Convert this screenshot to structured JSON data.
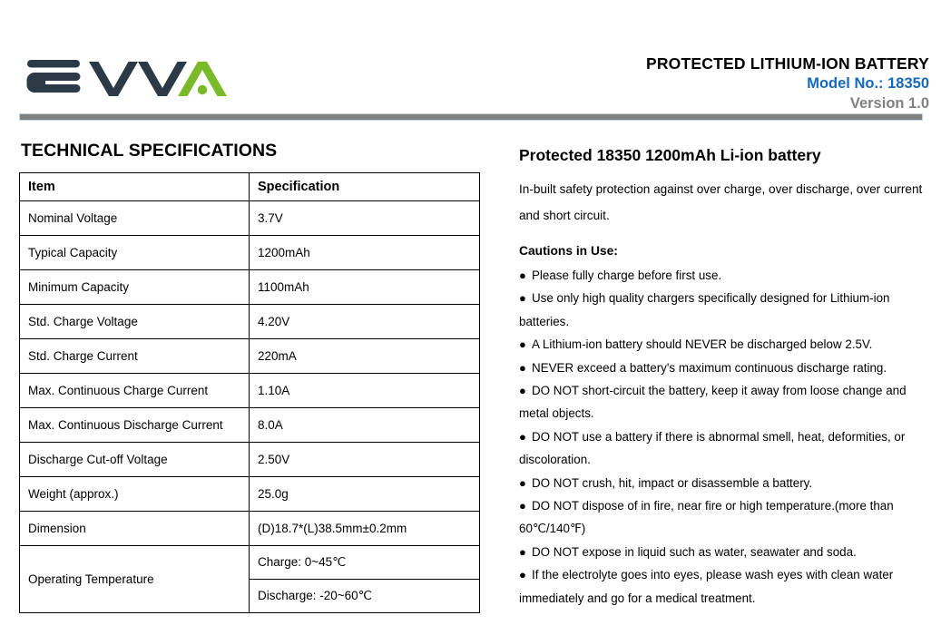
{
  "header": {
    "logo_text": "EVVA",
    "logo_colors": {
      "dark": "#2b3a46",
      "green": "#7ab929"
    },
    "title": "PROTECTED LITHIUM-ION BATTERY",
    "model": "Model No.: 18350",
    "version": "Version 1.0",
    "model_color": "#1569bd",
    "version_color": "#808080"
  },
  "left": {
    "section_title": "TECHNICAL SPECIFICATIONS",
    "table": {
      "columns": [
        "Item",
        "Specification"
      ],
      "rows": [
        {
          "item": "Nominal Voltage",
          "spec": "3.7V"
        },
        {
          "item": "Typical Capacity",
          "spec": "1200mAh"
        },
        {
          "item": "Minimum Capacity",
          "spec": "1100mAh"
        },
        {
          "item": "Std. Charge Voltage",
          "spec": "4.20V"
        },
        {
          "item": "Std. Charge Current",
          "spec": "220mA"
        },
        {
          "item": "Max. Continuous Charge Current",
          "spec": "1.10A"
        },
        {
          "item": "Max. Continuous Discharge Current",
          "spec": "8.0A"
        },
        {
          "item": "Discharge Cut-off Voltage",
          "spec": "2.50V"
        },
        {
          "item": "Weight (approx.)",
          "spec": "25.0g"
        },
        {
          "item": "Dimension",
          "spec": "(D)18.7*(L)38.5mm±0.2mm"
        }
      ],
      "operating_temperature": {
        "item": "Operating Temperature",
        "charge": "Charge: 0~45℃",
        "discharge": "Discharge: -20~60℃"
      }
    }
  },
  "right": {
    "product_title": "Protected 18350 1200mAh Li-ion battery",
    "intro": "In-built safety protection against over charge, over discharge, over current and short circuit.",
    "cautions_title": "Cautions in Use:",
    "bullet_glyph": "●",
    "cautions": [
      "Please fully charge before first use.",
      "Use only high quality chargers specifically designed for Lithium-ion batteries.",
      "A Lithium-ion battery should NEVER be discharged below 2.5V.",
      "NEVER exceed a battery's maximum continuous discharge rating.",
      "DO NOT short-circuit the battery, keep it away from loose change and metal objects.",
      "DO NOT use a battery if there is abnormal smell, heat, deformities, or discoloration.",
      "DO NOT crush, hit, impact or disassemble a battery.",
      "DO NOT dispose of in fire, near fire or high temperature.(more than 60℃/140℉)",
      "DO NOT expose in liquid such as water, seawater and soda.",
      "If the electrolyte goes into eyes, please wash eyes with clean water immediately and go for a medical treatment."
    ]
  }
}
